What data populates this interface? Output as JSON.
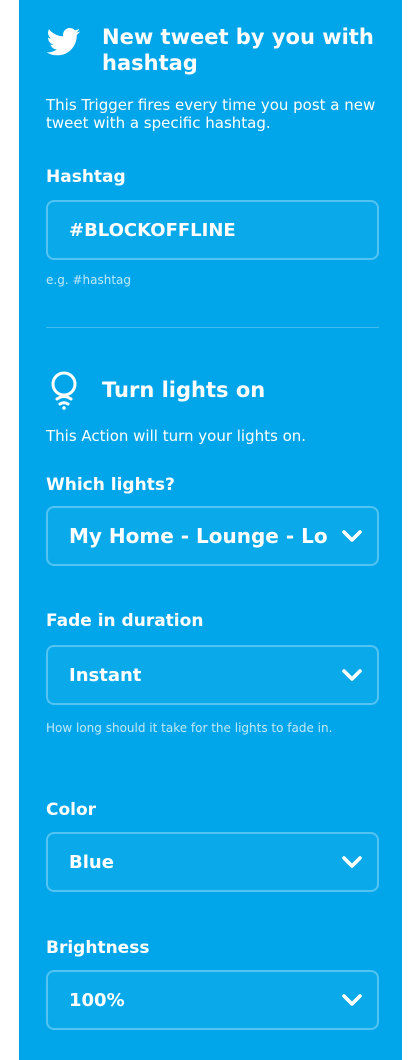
{
  "trigger": {
    "service_icon": "twitter-bird-icon",
    "title": "New tweet by you with hashtag",
    "description": "This Trigger fires every time you post a new tweet with a specific hashtag.",
    "fields": {
      "hashtag": {
        "label": "Hashtag",
        "value": "#BLOCKOFFLINE",
        "help": "e.g. #hashtag"
      }
    }
  },
  "action": {
    "service_icon": "lightbulb-wifi-icon",
    "title": "Turn lights on",
    "description": "This Action will turn your lights on.",
    "fields": {
      "which_lights": {
        "label": "Which lights?",
        "value": "My Home - Lounge - Lo"
      },
      "fade": {
        "label": "Fade in duration",
        "value": "Instant",
        "help": "How long should it take for the lights to fade in."
      },
      "color": {
        "label": "Color",
        "value": "Blue"
      },
      "brightness": {
        "label": "Brightness",
        "value": "100%"
      }
    }
  },
  "colors": {
    "background": "#01a6ea",
    "text": "#ffffff"
  }
}
